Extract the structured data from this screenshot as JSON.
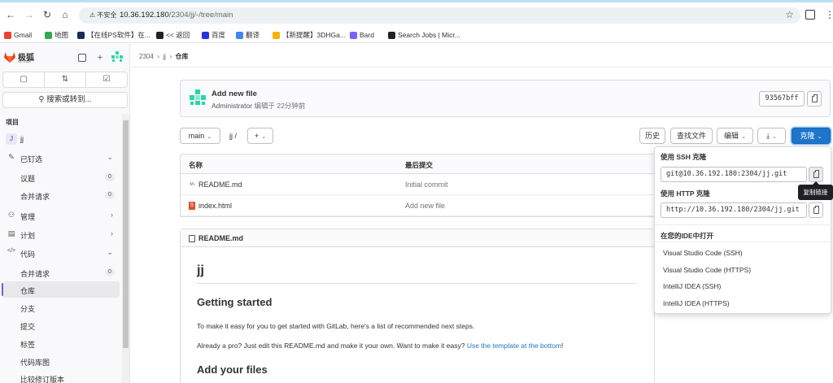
{
  "browser": {
    "security_label": "不安全",
    "url_host": "10.36.192.180",
    "url_path": "/2304/jj/-/tree/main",
    "bookmarks": [
      {
        "label": "Gmail",
        "color": "#ea4335"
      },
      {
        "label": "地图",
        "color": "#34a853"
      },
      {
        "label": "【在线PS软件】在...",
        "color": "#1a2a5a"
      },
      {
        "label": "<< 返回",
        "color": "#222222"
      },
      {
        "label": "百度",
        "color": "#2932e1"
      },
      {
        "label": "翻译",
        "color": "#4285f4"
      },
      {
        "label": "【新提醒】3DHGa...",
        "color": "#f4b400"
      },
      {
        "label": "Bard",
        "color": "#7b61ff"
      },
      {
        "label": "Search Jobs | Micr...",
        "color": "#222222"
      }
    ]
  },
  "sidebar": {
    "brand": "极狐",
    "brand_sub": "GITLAB",
    "search_label": "搜索或转到...",
    "section_label": "项目",
    "project_initial": "J",
    "project_name": "jj",
    "items": [
      {
        "label": "已钉选",
        "icon": "pin-icon",
        "chevron": "⌄"
      },
      {
        "label": "议题",
        "count": "0",
        "sub": true
      },
      {
        "label": "合并请求",
        "count": "0",
        "sub": true
      },
      {
        "label": "管理",
        "icon": "manage-icon",
        "chevron": "›"
      },
      {
        "label": "计划",
        "icon": "plan-icon",
        "chevron": "›"
      },
      {
        "label": "代码",
        "icon": "code-icon",
        "chevron": "⌄"
      },
      {
        "label": "合并请求",
        "count": "0",
        "sub": true
      },
      {
        "label": "仓库",
        "sub": true,
        "active": true
      },
      {
        "label": "分支",
        "sub": true
      },
      {
        "label": "提交",
        "sub": true
      },
      {
        "label": "标签",
        "sub": true
      },
      {
        "label": "代码库图",
        "sub": true
      },
      {
        "label": "比较修订版本",
        "sub": true
      }
    ]
  },
  "breadcrumb": {
    "parts": [
      "2304",
      "jj"
    ],
    "current": "仓库"
  },
  "last_commit": {
    "title": "Add new file",
    "author": "Administrator",
    "verb": "编辑于",
    "time": "22分钟前",
    "sha": "93567bff"
  },
  "toolbar": {
    "branch": "main",
    "path": "jj /",
    "add": "+",
    "history": "历史",
    "find_file": "查找文件",
    "edit": "编辑",
    "clone": "克隆"
  },
  "files": {
    "col_name": "名称",
    "col_commit": "最后提交",
    "rows": [
      {
        "name": "README.md",
        "commit": "Initial commit",
        "icon": "markdown-icon"
      },
      {
        "name": "index.html",
        "commit": "Add new file",
        "icon": "html-icon"
      }
    ]
  },
  "readme": {
    "file": "README.md",
    "h1": "jj",
    "h2_1": "Getting started",
    "p1": "To make it easy for you to get started with GitLab, here's a list of recommended next steps.",
    "p2": "Already a pro? Just edit this README.md and make it your own. Want to make it easy? ",
    "p2_link": "Use the template at the bottom",
    "p2_end": "!",
    "h2_2": "Add your files"
  },
  "clone_dropdown": {
    "ssh_label": "使用 SSH 克隆",
    "ssh_url": "git@10.36.192.180:2304/jj.git",
    "http_label": "使用 HTTP 克隆",
    "http_url": "http://10.36.192.180/2304/jj.git",
    "ide_label": "在您的IDE中打开",
    "ide_items": [
      "Visual Studio Code (SSH)",
      "Visual Studio Code (HTTPS)",
      "IntelliJ IDEA (SSH)",
      "IntelliJ IDEA (HTTPS)"
    ],
    "tooltip": "复制链接"
  },
  "colors": {
    "primary": "#1f75cb",
    "accent_purple": "#6666cc"
  }
}
